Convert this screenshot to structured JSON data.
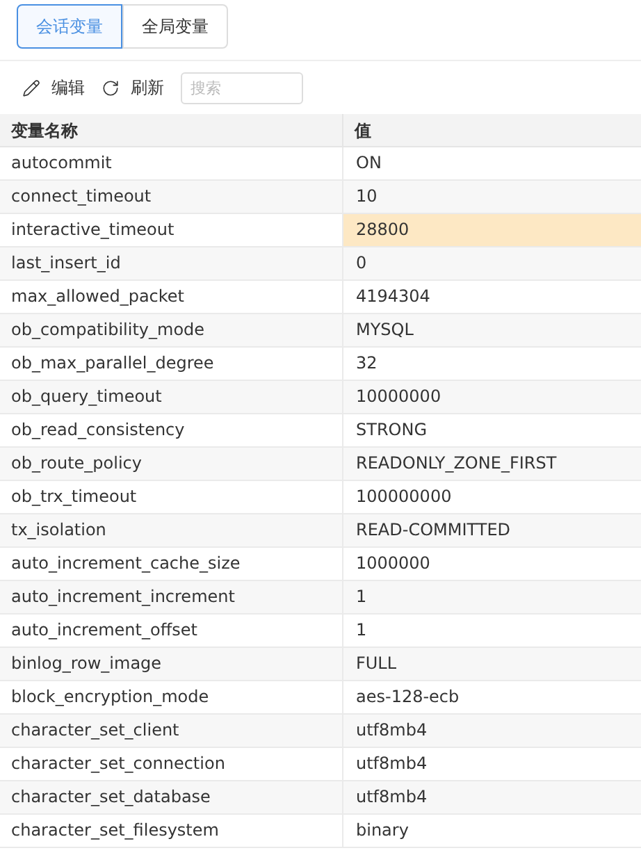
{
  "tabs": [
    {
      "label": "会话变量",
      "selected": true
    },
    {
      "label": "全局变量",
      "selected": false
    }
  ],
  "toolbar": {
    "edit": "编辑",
    "refresh": "刷新",
    "search": {
      "placeholder": "搜索"
    }
  },
  "table": {
    "columns": [
      "变量名称",
      "值"
    ],
    "rows": [
      {
        "name": "autocommit",
        "value": "ON",
        "selected": false
      },
      {
        "name": "connect_timeout",
        "value": "10",
        "selected": false
      },
      {
        "name": "interactive_timeout",
        "value": "28800",
        "selected": true
      },
      {
        "name": "last_insert_id",
        "value": "0",
        "selected": false
      },
      {
        "name": "max_allowed_packet",
        "value": "4194304",
        "selected": false
      },
      {
        "name": "ob_compatibility_mode",
        "value": "MYSQL",
        "selected": false
      },
      {
        "name": "ob_max_parallel_degree",
        "value": "32",
        "selected": false
      },
      {
        "name": "ob_query_timeout",
        "value": "10000000",
        "selected": false
      },
      {
        "name": "ob_read_consistency",
        "value": "STRONG",
        "selected": false
      },
      {
        "name": "ob_route_policy",
        "value": "READONLY_ZONE_FIRST",
        "selected": false
      },
      {
        "name": "ob_trx_timeout",
        "value": "100000000",
        "selected": false
      },
      {
        "name": "tx_isolation",
        "value": "READ-COMMITTED",
        "selected": false
      },
      {
        "name": "auto_increment_cache_size",
        "value": "1000000",
        "selected": false
      },
      {
        "name": "auto_increment_increment",
        "value": "1",
        "selected": false
      },
      {
        "name": "auto_increment_offset",
        "value": "1",
        "selected": false
      },
      {
        "name": "binlog_row_image",
        "value": "FULL",
        "selected": false
      },
      {
        "name": "block_encryption_mode",
        "value": "aes-128-ecb",
        "selected": false
      },
      {
        "name": "character_set_client",
        "value": "utf8mb4",
        "selected": false
      },
      {
        "name": "character_set_connection",
        "value": "utf8mb4",
        "selected": false
      },
      {
        "name": "character_set_database",
        "value": "utf8mb4",
        "selected": false
      },
      {
        "name": "character_set_filesystem",
        "value": "binary",
        "selected": false
      }
    ]
  }
}
